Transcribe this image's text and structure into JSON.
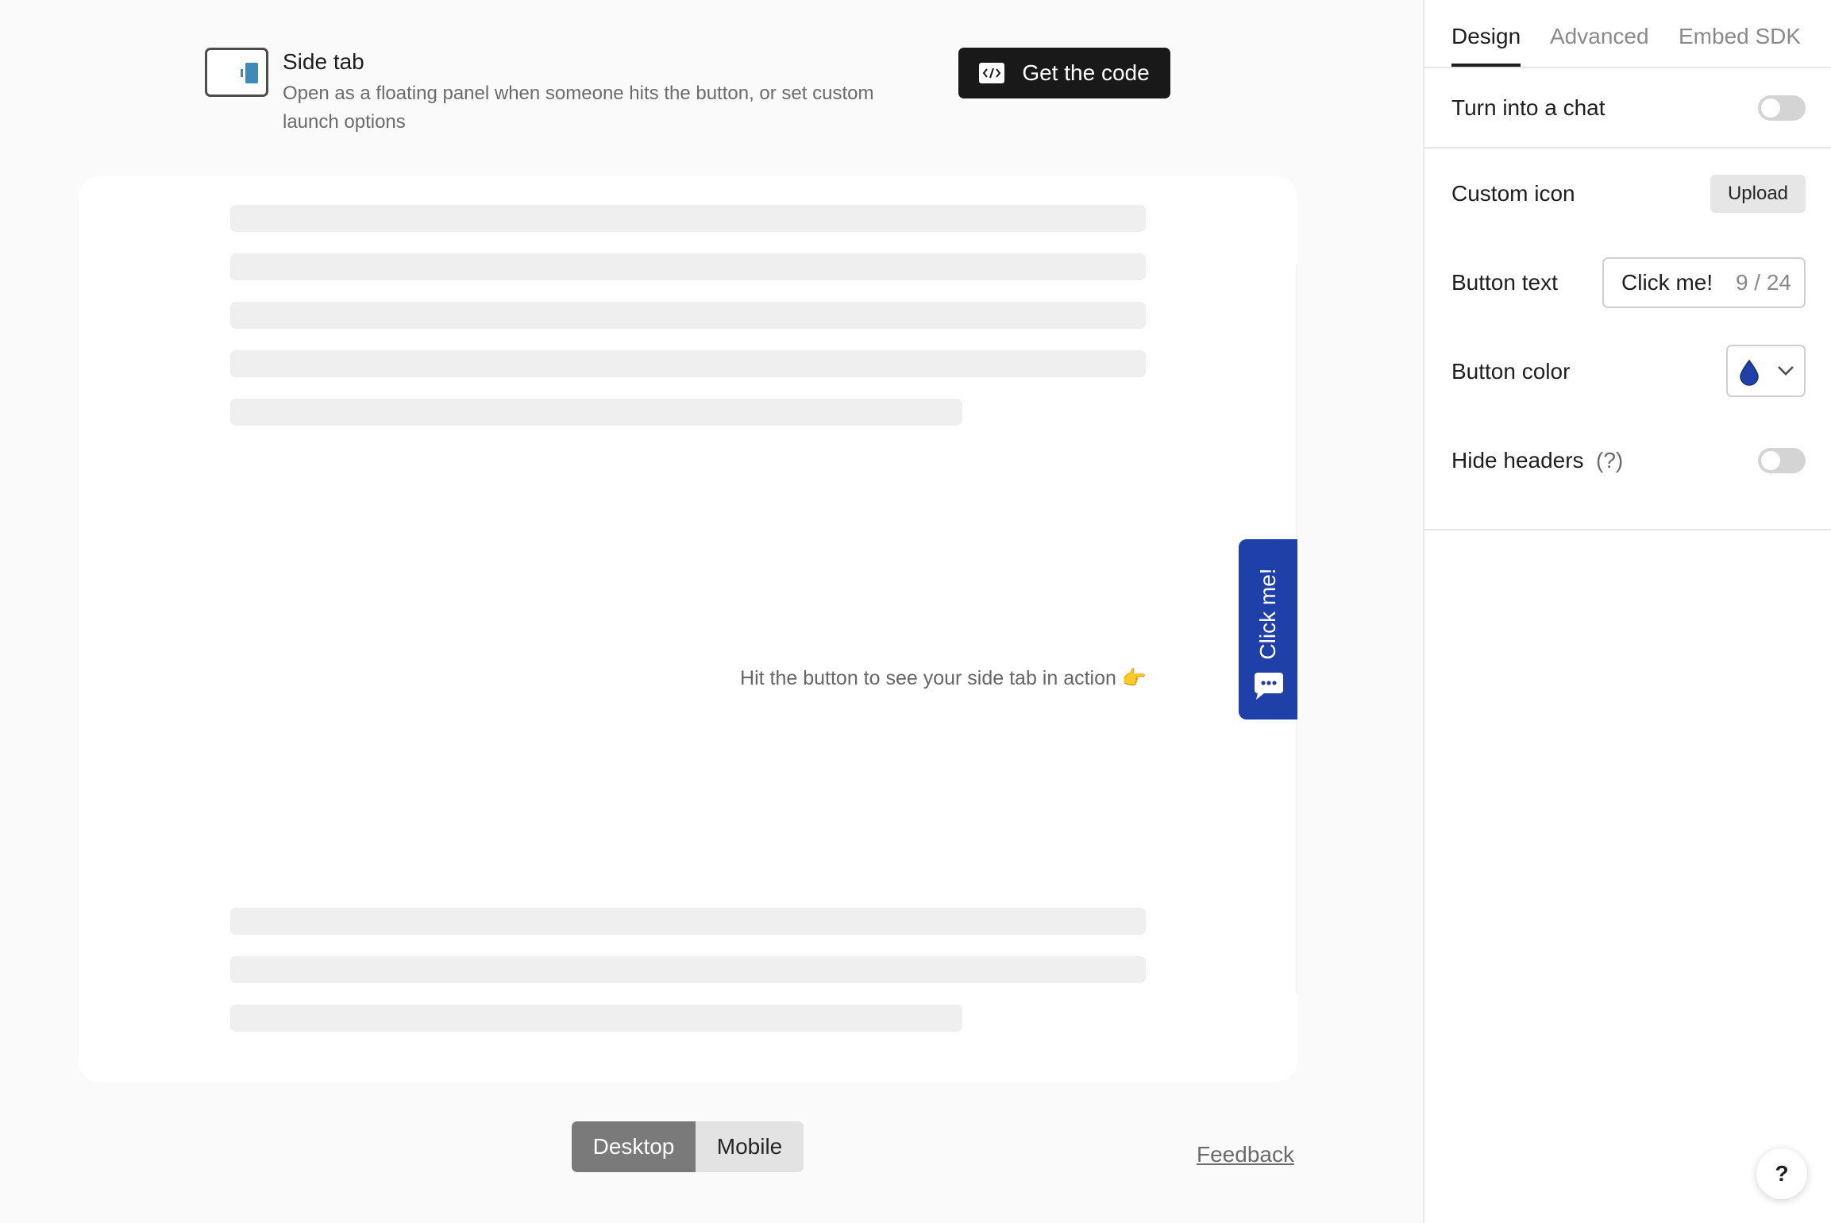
{
  "embed": {
    "title": "Side tab",
    "description": "Open as a floating panel when someone hits the button, or set custom launch options",
    "get_code_label": "Get the code"
  },
  "preview": {
    "hint": "Hit the button to see your side tab in action 👉",
    "side_tab_label": "Click me!"
  },
  "device_switch": {
    "options": [
      "Desktop",
      "Mobile"
    ],
    "selected": "Desktop"
  },
  "feedback_label": "Feedback",
  "panel": {
    "tabs": [
      "Design",
      "Advanced",
      "Embed SDK"
    ],
    "active_tab": "Design",
    "chat": {
      "label": "Turn into a chat",
      "enabled": false
    },
    "custom_icon": {
      "label": "Custom icon",
      "upload_label": "Upload"
    },
    "button_text": {
      "label": "Button text",
      "value": "Click me!",
      "counter": "9 / 24"
    },
    "button_color": {
      "label": "Button color",
      "value": "#1f40a8"
    },
    "hide_headers": {
      "label": "Hide headers",
      "help": "(?)",
      "enabled": false
    }
  },
  "help_button_label": "?",
  "colors": {
    "accent": "#1f40a8",
    "dark_button": "#191919",
    "preview_icon": "#3f8ab8"
  }
}
